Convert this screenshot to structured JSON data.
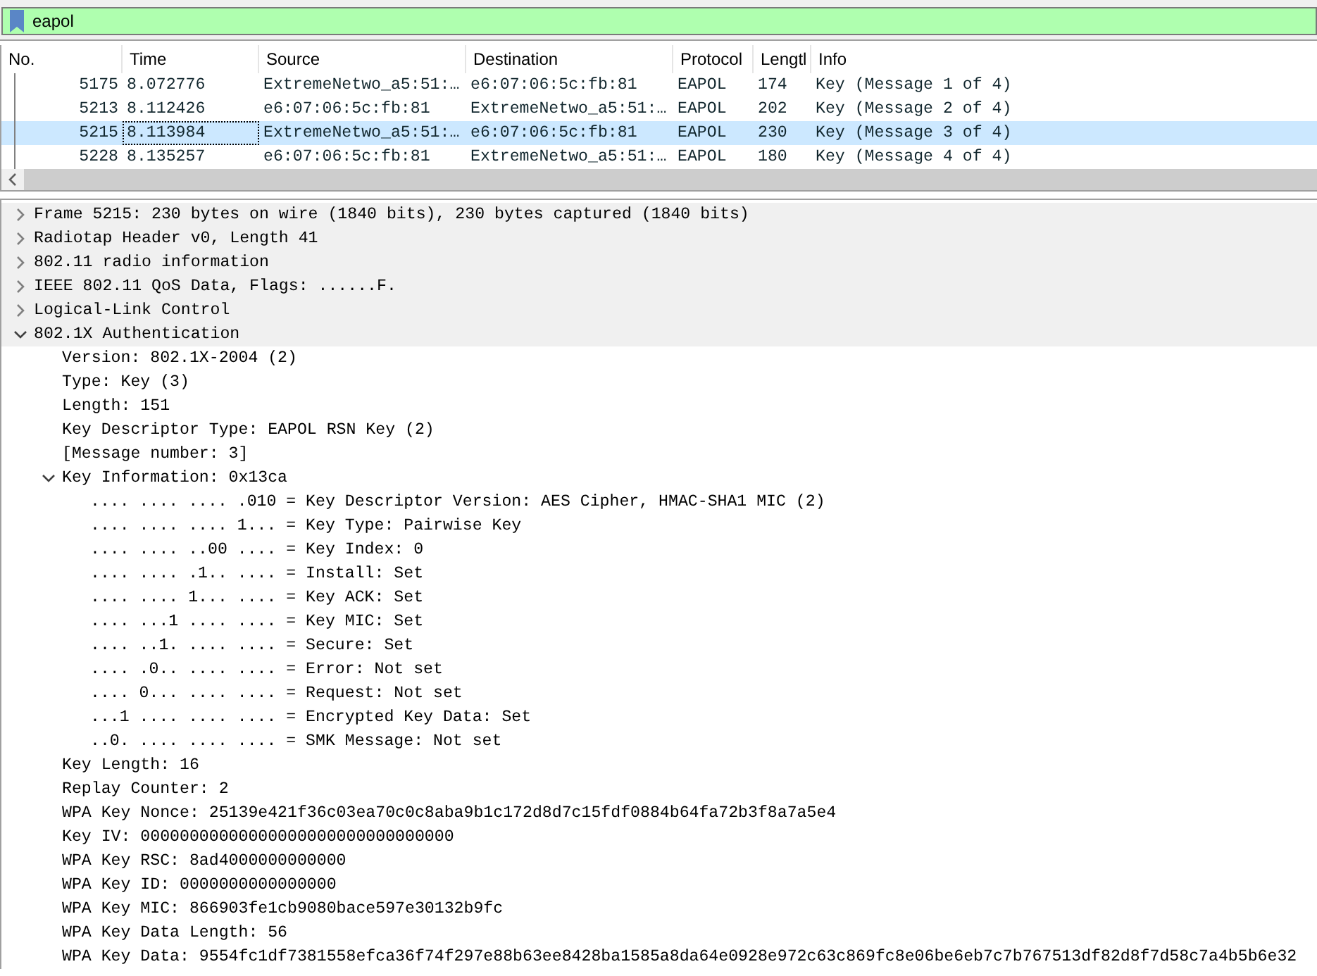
{
  "filter": {
    "value": "eapol"
  },
  "packet_list": {
    "columns": [
      "No.",
      "Time",
      "Source",
      "Destination",
      "Protocol",
      "Lengtl",
      "Info"
    ],
    "rows": [
      {
        "cells": [
          "5175",
          "8.072776",
          "ExtremeNetwo_a5:51:…",
          "e6:07:06:5c:fb:81",
          "EAPOL",
          "174",
          "Key (Message 1 of 4)"
        ],
        "selected": false
      },
      {
        "cells": [
          "5213",
          "8.112426",
          "e6:07:06:5c:fb:81",
          "ExtremeNetwo_a5:51:…",
          "EAPOL",
          "202",
          "Key (Message 2 of 4)"
        ],
        "selected": false
      },
      {
        "cells": [
          "5215",
          "8.113984",
          "ExtremeNetwo_a5:51:…",
          "e6:07:06:5c:fb:81",
          "EAPOL",
          "230",
          "Key (Message 3 of 4)"
        ],
        "selected": true
      },
      {
        "cells": [
          "5228",
          "8.135257",
          "e6:07:06:5c:fb:81",
          "ExtremeNetwo_a5:51:…",
          "EAPOL",
          "180",
          "Key (Message 4 of 4)"
        ],
        "selected": false
      }
    ]
  },
  "details": {
    "items": [
      {
        "text": "Frame 5215: 230 bytes on wire (1840 bits), 230 bytes captured (1840 bits)",
        "expanded": false
      },
      {
        "text": "Radiotap Header v0, Length 41",
        "expanded": false
      },
      {
        "text": "802.11 radio information",
        "expanded": false
      },
      {
        "text": "IEEE 802.11 QoS Data, Flags: ......F.",
        "expanded": false
      },
      {
        "text": "Logical-Link Control",
        "expanded": false
      },
      {
        "text": "802.1X Authentication",
        "expanded": true,
        "children": [
          {
            "text": "Version: 802.1X-2004 (2)"
          },
          {
            "text": "Type: Key (3)"
          },
          {
            "text": "Length: 151"
          },
          {
            "text": "Key Descriptor Type: EAPOL RSN Key (2)"
          },
          {
            "text": "[Message number: 3]"
          },
          {
            "text": "Key Information: 0x13ca",
            "expanded": true,
            "children": [
              {
                "text": ".... .... .... .010 = Key Descriptor Version: AES Cipher, HMAC-SHA1 MIC (2)"
              },
              {
                "text": ".... .... .... 1... = Key Type: Pairwise Key"
              },
              {
                "text": ".... .... ..00 .... = Key Index: 0"
              },
              {
                "text": ".... .... .1.. .... = Install: Set"
              },
              {
                "text": ".... .... 1... .... = Key ACK: Set"
              },
              {
                "text": ".... ...1 .... .... = Key MIC: Set"
              },
              {
                "text": ".... ..1. .... .... = Secure: Set"
              },
              {
                "text": ".... .0.. .... .... = Error: Not set"
              },
              {
                "text": ".... 0... .... .... = Request: Not set"
              },
              {
                "text": "...1 .... .... .... = Encrypted Key Data: Set"
              },
              {
                "text": "..0. .... .... .... = SMK Message: Not set"
              }
            ]
          },
          {
            "text": "Key Length: 16"
          },
          {
            "text": "Replay Counter: 2"
          },
          {
            "text": "WPA Key Nonce: 25139e421f36c03ea70c0c8aba9b1c172d8d7c15fdf0884b64fa72b3f8a7a5e4"
          },
          {
            "text": "Key IV: 00000000000000000000000000000000"
          },
          {
            "text": "WPA Key RSC: 8ad4000000000000"
          },
          {
            "text": "WPA Key ID: 0000000000000000"
          },
          {
            "text": "WPA Key MIC: 866903fe1cb9080bace597e30132b9fc"
          },
          {
            "text": "WPA Key Data Length: 56"
          },
          {
            "text": "WPA Key Data: 9554fc1df7381558efca36f74f297e88b63ee8428ba1585a8da64e0928e972c63c869fc8e06be6eb7c7b767513df82d8f7d58c7a4b5b6e32"
          }
        ]
      }
    ]
  }
}
